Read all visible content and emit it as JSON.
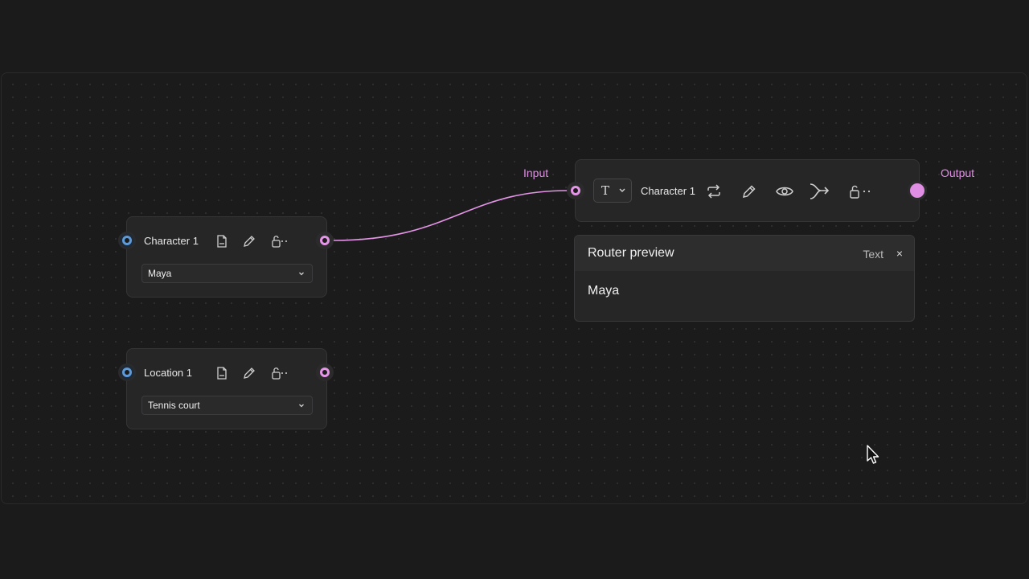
{
  "nodes": {
    "character": {
      "title": "Character 1",
      "value": "Maya"
    },
    "location": {
      "title": "Location 1",
      "value": "Tennis court"
    },
    "router": {
      "title": "Character 1",
      "input_label": "Input",
      "output_label": "Output",
      "type_glyph": "T"
    }
  },
  "preview": {
    "title": "Router preview",
    "type": "Text",
    "close": "×",
    "body": "Maya"
  },
  "icons": [
    "doc-icon",
    "pencil-icon",
    "lock-open-icon",
    "more-icon",
    "repeat-icon",
    "eye-icon",
    "branch-icon",
    "chevron-down-icon",
    "mouse-cursor-icon"
  ],
  "colors": {
    "accent_pink": "#e08ee4",
    "port_blue": "#5f9bd8",
    "node_bg": "#262627",
    "canvas_bg": "#1b1b1c"
  }
}
